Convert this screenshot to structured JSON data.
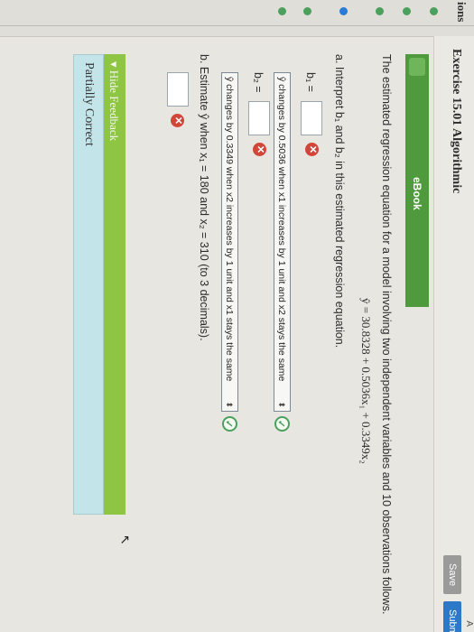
{
  "nav": {
    "header": "ions"
  },
  "header": {
    "exercise_title": "Exercise 15.01 Algorithmic",
    "save_label": "Save",
    "submit_label": "Submit",
    "top_right": "A"
  },
  "ebook": {
    "label": "eBook"
  },
  "problem": {
    "intro": "The estimated regression equation for a model involving two independent variables and 10 observations follows.",
    "equation": "ŷ = 30.8328 + 0.5036x₁ + 0.3349x₂",
    "part_a": "a. Interpret b₁ and b₂ in this estimated regression equation.",
    "b1_label": "b₁ =",
    "b2_label": "b₂ =",
    "b1_select": "ŷ changes by 0.5036 when x1 increases by 1 unit and x2 stays the same",
    "b2_select": "ŷ changes by 0.3349 when x2 increases by 1 unit and x1 stays the same",
    "part_b": "b. Estimate ŷ when x₁ = 180 and x₂ = 310 (to 3 decimals).",
    "wrong_mark": "✕",
    "right_mark": "✓"
  },
  "feedback": {
    "toggle_label": "▾ Hide Feedback",
    "status": "Partially Correct"
  },
  "colors": {
    "accent_green": "#4f9a3d",
    "feedback_green": "#8ec542",
    "error_red": "#d2463a",
    "submit_blue": "#2c79c7"
  }
}
